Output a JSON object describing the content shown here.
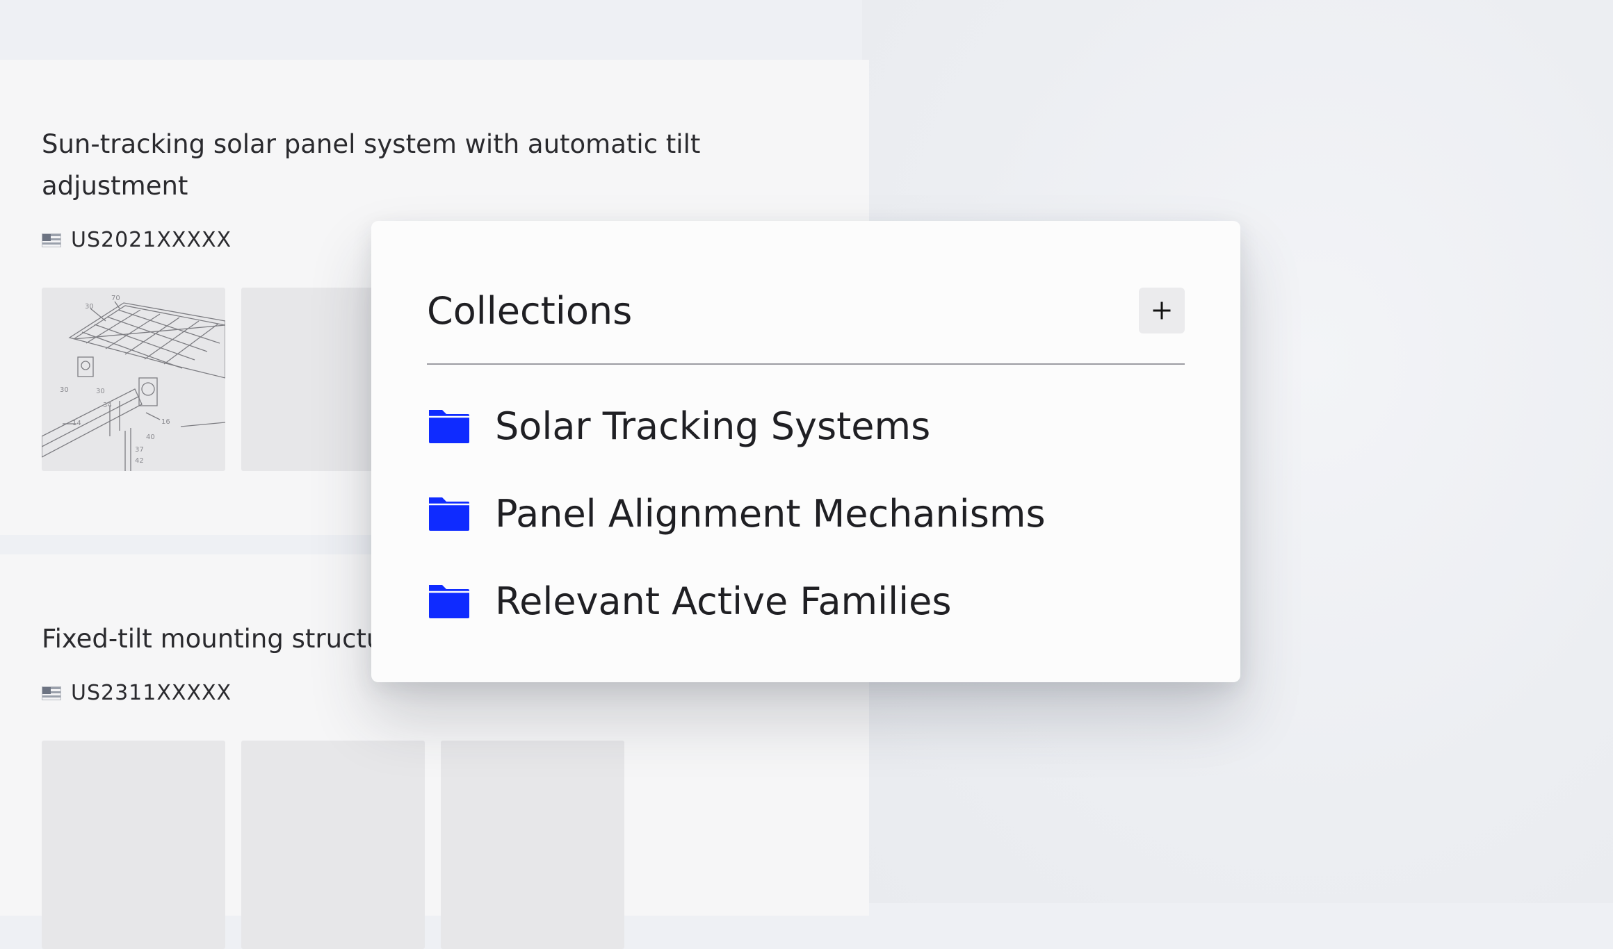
{
  "results": [
    {
      "title": "Sun-tracking solar panel system with automatic tilt adjustment",
      "number": "US2021XXXXX",
      "country_icon": "us-flag-icon"
    },
    {
      "title": "Fixed-tilt mounting structu",
      "number": "US2311XXXXX",
      "country_icon": "us-flag-icon"
    }
  ],
  "collections_popover": {
    "title": "Collections",
    "add_button_icon": "plus-icon",
    "folder_icon": "folder-icon",
    "folder_color": "#0f2bff",
    "items": [
      {
        "label": "Solar Tracking Systems"
      },
      {
        "label": "Panel Alignment Mechanisms"
      },
      {
        "label": "Relevant Active Families"
      }
    ]
  }
}
